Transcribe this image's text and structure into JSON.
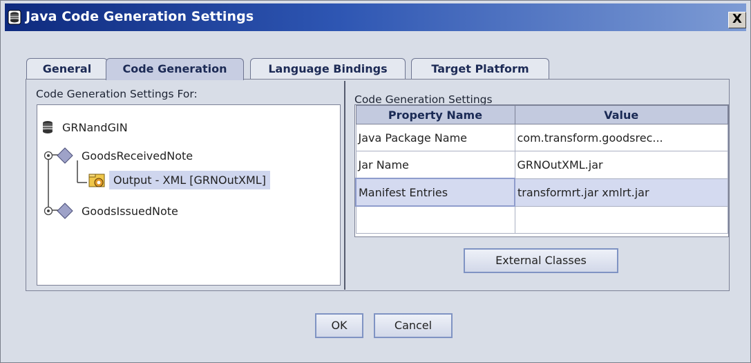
{
  "window": {
    "title": "Java Code Generation Settings",
    "close_label": "X"
  },
  "tabs": [
    {
      "label": "General",
      "active": false
    },
    {
      "label": "Code Generation",
      "active": true
    },
    {
      "label": "Language Bindings",
      "active": false
    },
    {
      "label": "Target Platform",
      "active": false
    }
  ],
  "left_panel": {
    "heading": "Code Generation Settings For:",
    "tree": [
      {
        "label": "GRNandGIN",
        "icon": "database-icon"
      },
      {
        "label": "GoodsReceivedNote",
        "icon": "diamond-icon"
      },
      {
        "label": "Output - XML [GRNOutXML]",
        "icon": "folder-gear-icon",
        "selected": true
      },
      {
        "label": "GoodsIssuedNote",
        "icon": "diamond-icon"
      }
    ]
  },
  "right_panel": {
    "heading": "Code Generation Settings",
    "columns": [
      "Property Name",
      "Value"
    ],
    "rows": [
      [
        "Java Package Name",
        "com.transform.goodsrec..."
      ],
      [
        "Jar Name",
        "GRNOutXML.jar"
      ],
      [
        "Manifest Entries",
        "transformrt.jar xmlrt.jar"
      ]
    ],
    "external_classes_label": "External Classes"
  },
  "footer": {
    "ok_label": "OK",
    "cancel_label": "Cancel"
  },
  "colors": {
    "title_bar_start": "#0e2a7e",
    "title_bar_end": "#7d9bd4",
    "dialog_bg": "#d8dde7",
    "selection": "#cfd6ee"
  }
}
